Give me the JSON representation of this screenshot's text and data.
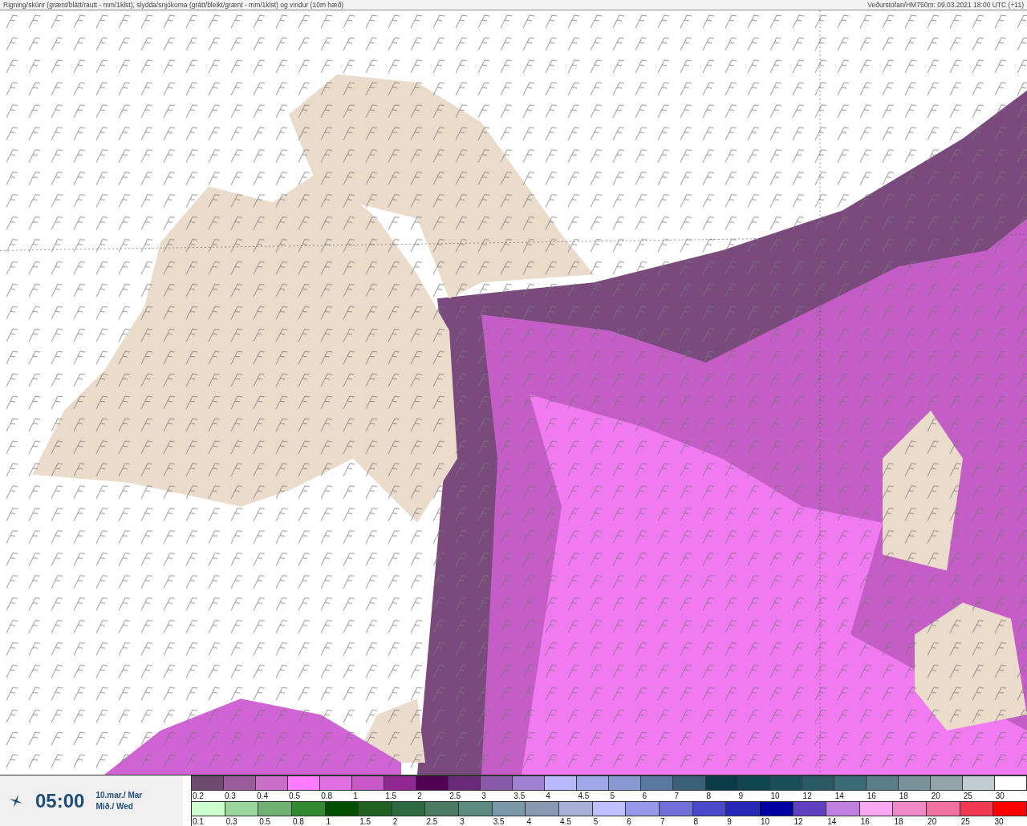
{
  "header": {
    "title": "Rigning/skúrir (grænt/blátt/rautt - mm/1klst), slydda/snjókoma (grátt/bleikt/grænt - mm/1klst) og vindur (10m hæð)",
    "source": "Veðurstofan/HM750m: 09.03.2021 18:00 UTC (+11)"
  },
  "time_panel": {
    "time": "05:00",
    "date": "10.mar./ Mar",
    "weekday": "Mið./ Wed"
  },
  "legend_rows": [
    {
      "items": [
        {
          "label": "0.2",
          "color": "#6e4a6e"
        },
        {
          "label": "0.3",
          "color": "#9a5c9a"
        },
        {
          "label": "0.4",
          "color": "#c86ec8"
        },
        {
          "label": "0.5",
          "color": "#ff7aff"
        },
        {
          "label": "0.8",
          "color": "#e070e0"
        },
        {
          "label": "1",
          "color": "#c858c8"
        },
        {
          "label": "1.5",
          "color": "#902890"
        },
        {
          "label": "2",
          "color": "#500050"
        },
        {
          "label": "2.5",
          "color": "#6a2a7a"
        },
        {
          "label": "3",
          "color": "#8a5aaa"
        },
        {
          "label": "3.5",
          "color": "#a080d0"
        },
        {
          "label": "4",
          "color": "#b8b8ff"
        },
        {
          "label": "4.5",
          "color": "#a0a8e8"
        },
        {
          "label": "5",
          "color": "#8898d0"
        },
        {
          "label": "6",
          "color": "#5a78a0"
        },
        {
          "label": "7",
          "color": "#3a6078"
        },
        {
          "label": "8",
          "color": "#0a3a48"
        },
        {
          "label": "9",
          "color": "#104650"
        },
        {
          "label": "10",
          "color": "#1a4e58"
        },
        {
          "label": "12",
          "color": "#2a5a64"
        },
        {
          "label": "14",
          "color": "#3a6a74"
        },
        {
          "label": "16",
          "color": "#5a7e88"
        },
        {
          "label": "18",
          "color": "#78929a"
        },
        {
          "label": "20",
          "color": "#90a4aa"
        },
        {
          "label": "25",
          "color": "#c0ccd0"
        },
        {
          "label": "30",
          "color": "#ffffff"
        }
      ]
    },
    {
      "items": [
        {
          "label": "0.1",
          "color": "#ccffcc"
        },
        {
          "label": "0.3",
          "color": "#99d699"
        },
        {
          "label": "0.5",
          "color": "#70b070"
        },
        {
          "label": "0.8",
          "color": "#308a30"
        },
        {
          "label": "1",
          "color": "#005000"
        },
        {
          "label": "1.5",
          "color": "#206020"
        },
        {
          "label": "2",
          "color": "#2e6a40"
        },
        {
          "label": "2.5",
          "color": "#4a7a60"
        },
        {
          "label": "3",
          "color": "#5a8a80"
        },
        {
          "label": "3.5",
          "color": "#7a98a8"
        },
        {
          "label": "4",
          "color": "#8898b0"
        },
        {
          "label": "4.5",
          "color": "#a8b0d8"
        },
        {
          "label": "5",
          "color": "#c0c0ff"
        },
        {
          "label": "6",
          "color": "#9898e8"
        },
        {
          "label": "7",
          "color": "#7070d8"
        },
        {
          "label": "8",
          "color": "#4848c8"
        },
        {
          "label": "9",
          "color": "#2828b8"
        },
        {
          "label": "10",
          "color": "#0000a0"
        },
        {
          "label": "12",
          "color": "#6040c0"
        },
        {
          "label": "14",
          "color": "#c080e0"
        },
        {
          "label": "16",
          "color": "#f8a8f0"
        },
        {
          "label": "18",
          "color": "#f088c8"
        },
        {
          "label": "20",
          "color": "#f070a0"
        },
        {
          "label": "25",
          "color": "#f03850"
        },
        {
          "label": "30",
          "color": "#ff0000"
        }
      ]
    }
  ]
}
